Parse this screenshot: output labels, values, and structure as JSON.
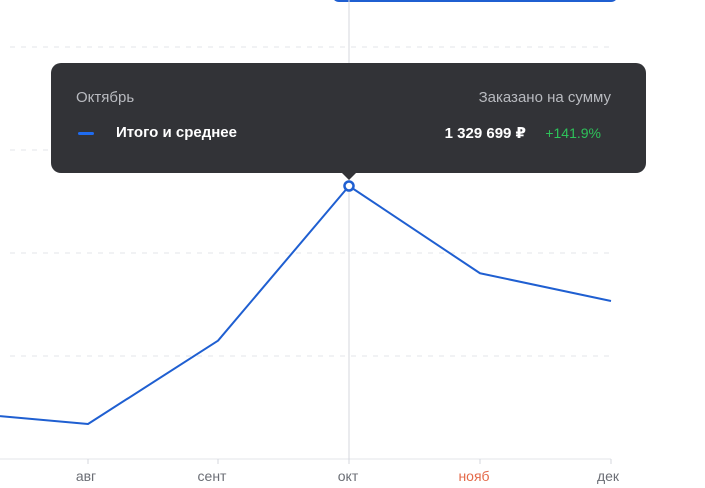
{
  "tooltip": {
    "month": "Октябрь",
    "metric": "Заказано на сумму",
    "series_name": "Итого и среднее",
    "amount": "1 329 699 ₽",
    "change": "+141.9%"
  },
  "colors": {
    "line": "#1f5fd1",
    "tooltip_bg": "#323337",
    "positive": "#2ec25a",
    "highlight_label": "#e46a4a",
    "grid": "#e3e4e8"
  },
  "chart_data": {
    "type": "line",
    "categories": [
      "",
      "авг",
      "сент",
      "окт",
      "нояб",
      "дек"
    ],
    "values": [
      0.42,
      0.4,
      0.61,
      1.0,
      0.78,
      0.71
    ],
    "active_category": "окт",
    "highlight_category": "нояб",
    "grid": true
  },
  "x_labels": {
    "aug": "авг",
    "sep": "сент",
    "oct": "окт",
    "nov": "нояб",
    "dec": "дек"
  }
}
